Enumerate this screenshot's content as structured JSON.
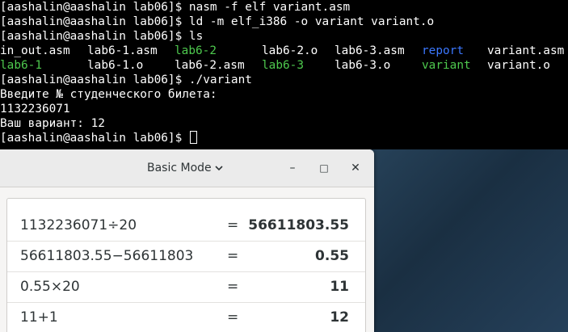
{
  "terminal": {
    "lines": [
      "[aashalin@aashalin lab06]$ nasm -f elf variant.asm",
      "[aashalin@aashalin lab06]$ ld -m elf_i386 -o variant variant.o",
      "[aashalin@aashalin lab06]$ ls"
    ],
    "ls_row1": [
      "in_out.asm",
      "lab6-1.asm",
      "lab6-2",
      "lab6-2.o",
      "lab6-3.asm",
      "report",
      "variant.asm"
    ],
    "ls_row2": [
      "lab6-1",
      "lab6-1.o",
      "lab6-2.asm",
      "lab6-3",
      "lab6-3.o",
      "variant",
      "variant.o"
    ],
    "run_cmd": "[aashalin@aashalin lab06]$ ./variant",
    "prompt_ticket": "Введите № студенческого билета:",
    "ticket_value": "1132236071",
    "variant_line": "Ваш вариант: 12",
    "final_prompt": "[aashalin@aashalin lab06]$ ",
    "colors": {
      "directory": "#3b78ff",
      "executable": "#4ec94e",
      "text": "#ffffff"
    }
  },
  "calculator": {
    "mode_label": "Basic Mode",
    "mode_icon": "chevron-down-icon",
    "minimize_glyph": "–",
    "maximize_glyph": "□",
    "close_glyph": "✕",
    "history": [
      {
        "expr": "1132236071÷20",
        "eq": "=",
        "result": "56611803.55"
      },
      {
        "expr": "56611803.55−56611803",
        "eq": "=",
        "result": "0.55"
      },
      {
        "expr": "0.55×20",
        "eq": "=",
        "result": "11"
      },
      {
        "expr": "11+1",
        "eq": "=",
        "result": "12"
      }
    ]
  }
}
